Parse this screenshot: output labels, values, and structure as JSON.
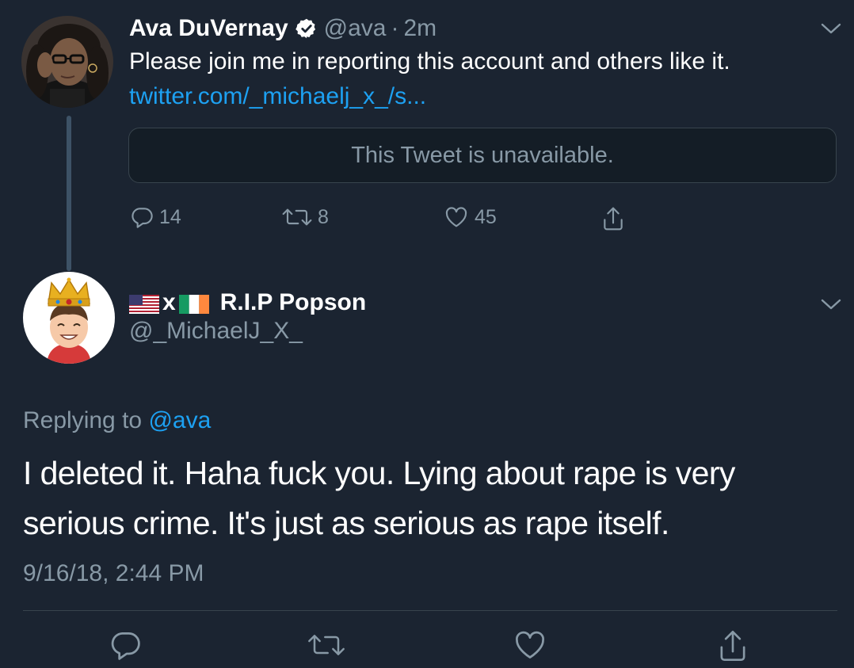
{
  "tweet1": {
    "name": "Ava DuVernay",
    "handle": "@ava",
    "separator": "·",
    "time": "2m",
    "text": "Please join me in reporting this account and others like it.",
    "link": "twitter.com/_michaelj_x_/s...",
    "quoted_unavailable": "This Tweet is unavailable.",
    "actions": {
      "replies": "14",
      "retweets": "8",
      "likes": "45"
    }
  },
  "tweet2": {
    "name_sep": "x",
    "name": "R.I.P Popson",
    "handle": "@_MichaelJ_X_",
    "replying_label": "Replying to",
    "replying_mention": "@ava",
    "text": "I deleted it. Haha fuck you. Lying about rape is very serious crime. It's just as serious as rape itself.",
    "timestamp": "9/16/18, 2:44 PM"
  },
  "colors": {
    "background": "#1b2431",
    "muted": "#8899a6",
    "link": "#1da1f2",
    "divider": "#38444d"
  },
  "icons": [
    "chevron-down-icon",
    "verified-badge-icon",
    "reply-icon",
    "retweet-icon",
    "like-icon",
    "share-icon",
    "us-flag-icon",
    "ireland-flag-icon"
  ]
}
